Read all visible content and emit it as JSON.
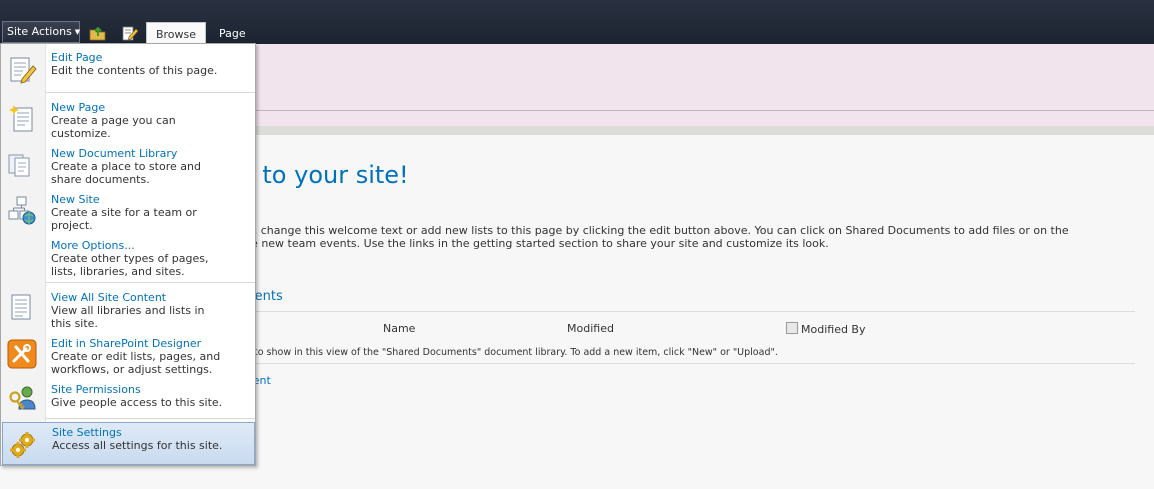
{
  "ribbon": {
    "site_actions_label": "Site Actions",
    "tabs": [
      {
        "label": "Browse",
        "active": true
      },
      {
        "label": "Page",
        "active": false
      }
    ]
  },
  "page": {
    "welcome_title": "e to your site!",
    "intro_line1": "ge, change this welcome text or add new lists to this page by clicking the edit button above. You can click on Shared Documents to add files or on the",
    "intro_line2": "ate new team events. Use the links in the getting started section to share your site and customize its look.",
    "section_title": "ments",
    "columns": [
      "Name",
      "Modified",
      "Modified By"
    ],
    "empty_message": "ns to show in this view of the \"Shared Documents\" document library. To add a new item, click \"New\" or \"Upload\".",
    "add_link": "ment"
  },
  "menu": {
    "items": [
      {
        "title": "Edit Page",
        "desc": "Edit the contents of this page.",
        "icon": "edit-page-icon"
      },
      {
        "title": "New Page",
        "desc": "Create a page you can\ncustomize.",
        "icon": "new-page-icon"
      },
      {
        "title": "New Document Library",
        "desc": "Create a place to store and\nshare documents.",
        "icon": "document-library-icon"
      },
      {
        "title": "New Site",
        "desc": "Create a site for a team or\nproject.",
        "icon": "new-site-icon"
      },
      {
        "title": "More Options...",
        "desc": "Create other types of pages,\nlists, libraries, and sites.",
        "icon": "more-options-icon"
      },
      {
        "title": "View All Site Content",
        "desc": "View all libraries and lists in\nthis site.",
        "icon": "site-content-icon"
      },
      {
        "title": "Edit in SharePoint Designer",
        "desc": "Create or edit lists, pages, and\nworkflows, or adjust settings.",
        "icon": "sharepoint-designer-icon"
      },
      {
        "title": "Site Permissions",
        "desc": "Give people access to this site.",
        "icon": "permissions-icon"
      },
      {
        "title": "Site Settings",
        "desc": "Access all settings for this site.",
        "icon": "settings-gear-icon",
        "highlighted": true
      }
    ]
  },
  "colors": {
    "ribbon_bg": "#1c2331",
    "link_blue": "#0072bc",
    "pink_band": "#f1e4ec",
    "menu_highlight": "#c9dbf0"
  }
}
